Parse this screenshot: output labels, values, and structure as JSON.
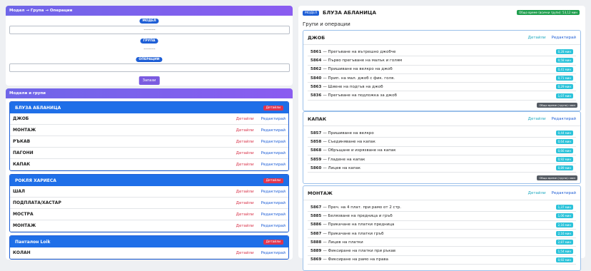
{
  "form": {
    "header": "Модел → Група → Операции",
    "model_label": "МОДЕЛ",
    "model_value": "---------",
    "group_label": "ГРУПА",
    "group_value": "---------",
    "ops_label": "ОПЕРАЦИИ",
    "save_label": "Запази"
  },
  "models": {
    "header": "Модели и групи",
    "details_button": "Детайли",
    "details_link": "Детайли",
    "edit_link": "Редактирай",
    "list": [
      {
        "name": "БЛУЗА АБЛАНИЦА",
        "groups": [
          "ДЖОБ",
          "МОНТАЖ",
          "РЪКАВ",
          "ПАГОНИ",
          "КАПАК"
        ]
      },
      {
        "name": "РОКЛЯ ХАРИЕСА",
        "groups": [
          "ШАЛ",
          "ПОДПЛАТА/ХАСТАР",
          "МОСТРА",
          "МОНТАЖ"
        ]
      },
      {
        "name": "Панталон Loik",
        "groups": [
          "КОЛАН"
        ]
      }
    ]
  },
  "detail": {
    "model_badge": "МОДЕЛ",
    "model_name": "БЛУЗА АБЛАНИЦА",
    "total_badge": "Общо време (всички групи): 53,12 мин",
    "subtitle": "Групи и операции",
    "details_link": "Детайли",
    "edit_link": "Редактирай",
    "group_total_label": "Общо време (група): мин",
    "groups": [
      {
        "name": "ДЖОБ",
        "ops": [
          {
            "code": "5861",
            "text": "— Прегъване на вътрешно джобче",
            "time": "0,28 мин"
          },
          {
            "code": "5864",
            "text": "— Първо прегъване на малък и голям",
            "time": "0,58 мин"
          },
          {
            "code": "5862",
            "text": "— Пришиване на велкро на джоб",
            "time": "0,41 мин"
          },
          {
            "code": "5840",
            "text": "— Прип. на мал. джоб с фик. голя.",
            "time": "0,71 мин"
          },
          {
            "code": "5863",
            "text": "— Шиене на подгъв на джоб",
            "time": "0,29 мин"
          },
          {
            "code": "5836",
            "text": "— Прегъване на подложка за джоб",
            "time": "1,07 мин"
          }
        ]
      },
      {
        "name": "КАПАК",
        "ops": [
          {
            "code": "5857",
            "text": "— Пришиване на велкро",
            "time": "0,44 мин"
          },
          {
            "code": "5858",
            "text": "— Съединяване на капак",
            "time": "0,64 мин"
          },
          {
            "code": "5868",
            "text": "— Обръщане и изрязване на капак",
            "time": "0,66 мин"
          },
          {
            "code": "5859",
            "text": "— Гладене на капак",
            "time": "0,92 мин"
          },
          {
            "code": "5860",
            "text": "— Лицев на капак",
            "time": "0,89 мин"
          }
        ]
      },
      {
        "name": "МОНТАЖ",
        "ops": [
          {
            "code": "5867",
            "text": "— Преч. на 4 плат. при рамо от 2 стр.",
            "time": "1,37 мин"
          },
          {
            "code": "5885",
            "text": "— Белязване на предница и гръб",
            "time": "1,06 мин"
          },
          {
            "code": "5886",
            "text": "— Прикачане на платки предница",
            "time": "2,16 мин"
          },
          {
            "code": "5887",
            "text": "— Прикачане на платки гръб",
            "time": "2,16 мин"
          },
          {
            "code": "5888",
            "text": "— Лицев на платки",
            "time": "2,87 мин"
          },
          {
            "code": "5889",
            "text": "— Фиксиране на платки при ръкав",
            "time": "1,54 мин"
          },
          {
            "code": "5869",
            "text": "— Фиксиране на рамо на права",
            "time": "0,92 мин"
          }
        ]
      }
    ]
  }
}
